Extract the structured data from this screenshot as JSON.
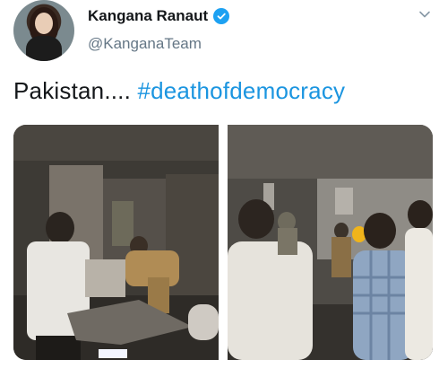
{
  "author": {
    "name": "Kangana Ranaut",
    "handle": "@KanganaTeam",
    "verified": true
  },
  "tweet": {
    "text_prefix": "Pakistan.... ",
    "hashtag": "#deathofdemocracy"
  },
  "media": [
    {
      "icon": "photo-demolished-room"
    },
    {
      "icon": "photo-officials-inspecting"
    }
  ],
  "colors": {
    "link": "#1b95e0",
    "verified": "#1da1f2",
    "muted": "#657786"
  }
}
